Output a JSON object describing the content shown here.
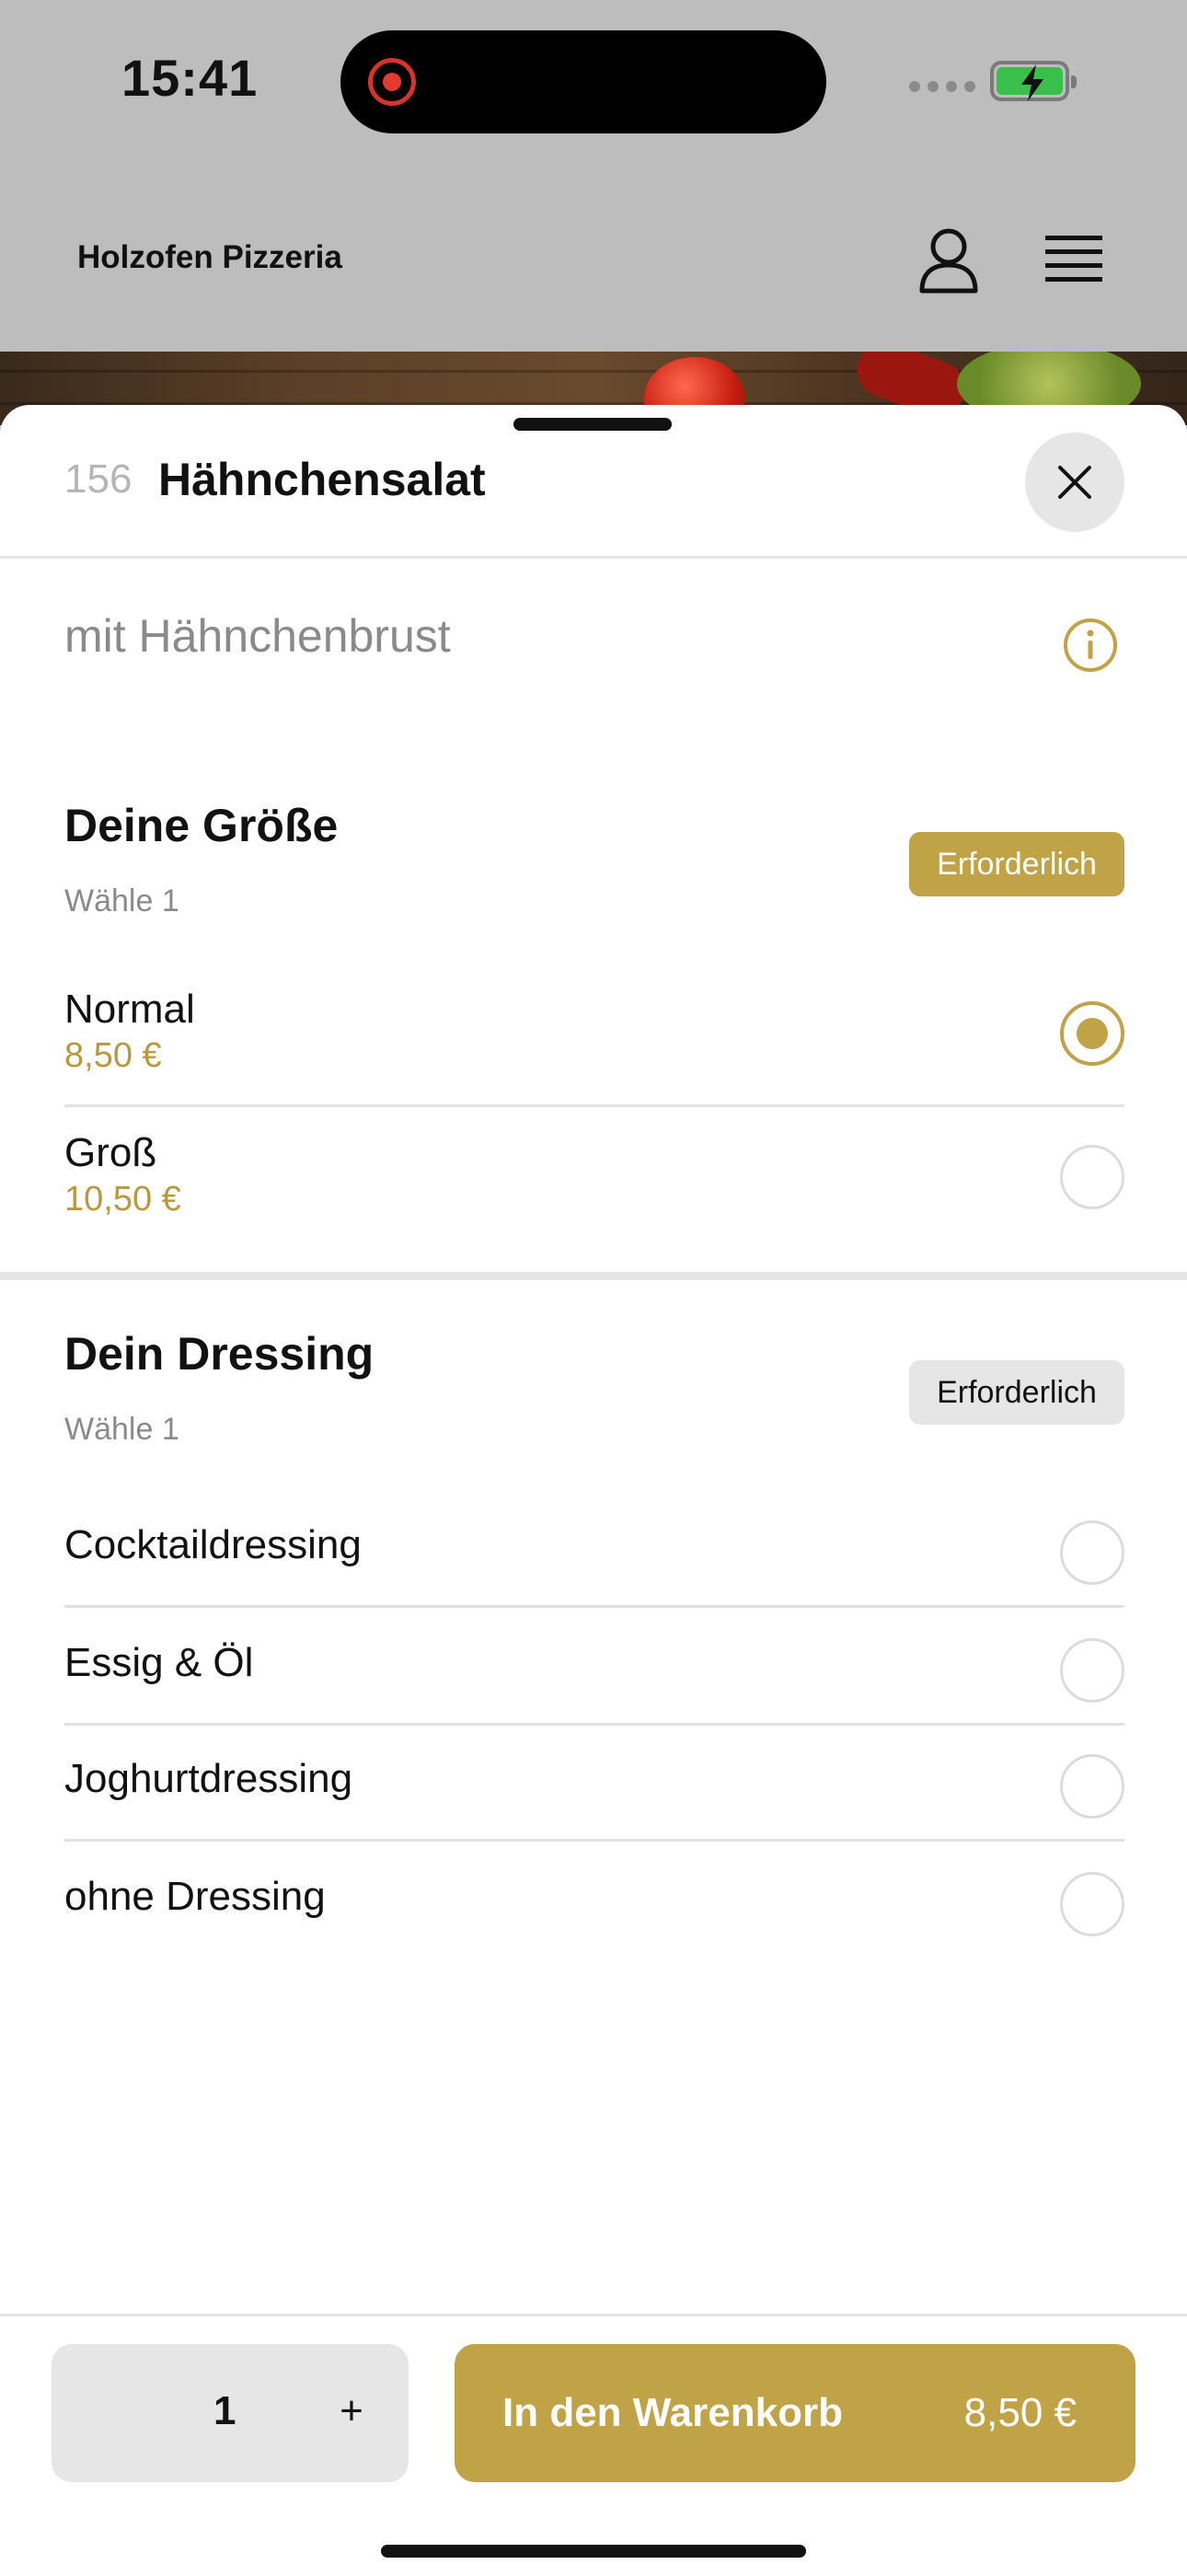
{
  "status_bar": {
    "time": "15:41",
    "battery_color": "#39c04b",
    "recording_color": "#e53a2e"
  },
  "header": {
    "brand": "Holzofen Pizzeria",
    "profile_icon": "user-icon",
    "menu_icon": "hamburger-menu-icon"
  },
  "sheet": {
    "item_number": "156",
    "title": "Hähnchensalat",
    "description": "mit Hähnchenbrust",
    "close_icon": "close-icon",
    "info_icon": "info-icon"
  },
  "size_group": {
    "title": "Deine Größe",
    "subtitle": "Wähle 1",
    "badge": "Erforderlich",
    "options": [
      {
        "label": "Normal",
        "price": "8,50 €",
        "selected": true
      },
      {
        "label": "Groß",
        "price": "10,50 €",
        "selected": false
      }
    ]
  },
  "dressing_group": {
    "title": "Dein Dressing",
    "subtitle": "Wähle 1",
    "badge": "Erforderlich",
    "options": [
      {
        "label": "Cocktaildressing",
        "selected": false
      },
      {
        "label": "Essig & Öl",
        "selected": false
      },
      {
        "label": "Joghurtdressing",
        "selected": false
      },
      {
        "label": "ohne Dressing",
        "selected": false
      }
    ]
  },
  "footer": {
    "quantity": "1",
    "plus_label": "+",
    "add_to_cart_label": "In den Warenkorb",
    "add_to_cart_price": "8,50 €"
  },
  "colors": {
    "accent": "#c0a247",
    "accent_text": "#b8993f",
    "muted": "#8a8a8a",
    "overlay": "#bdbdbd"
  }
}
